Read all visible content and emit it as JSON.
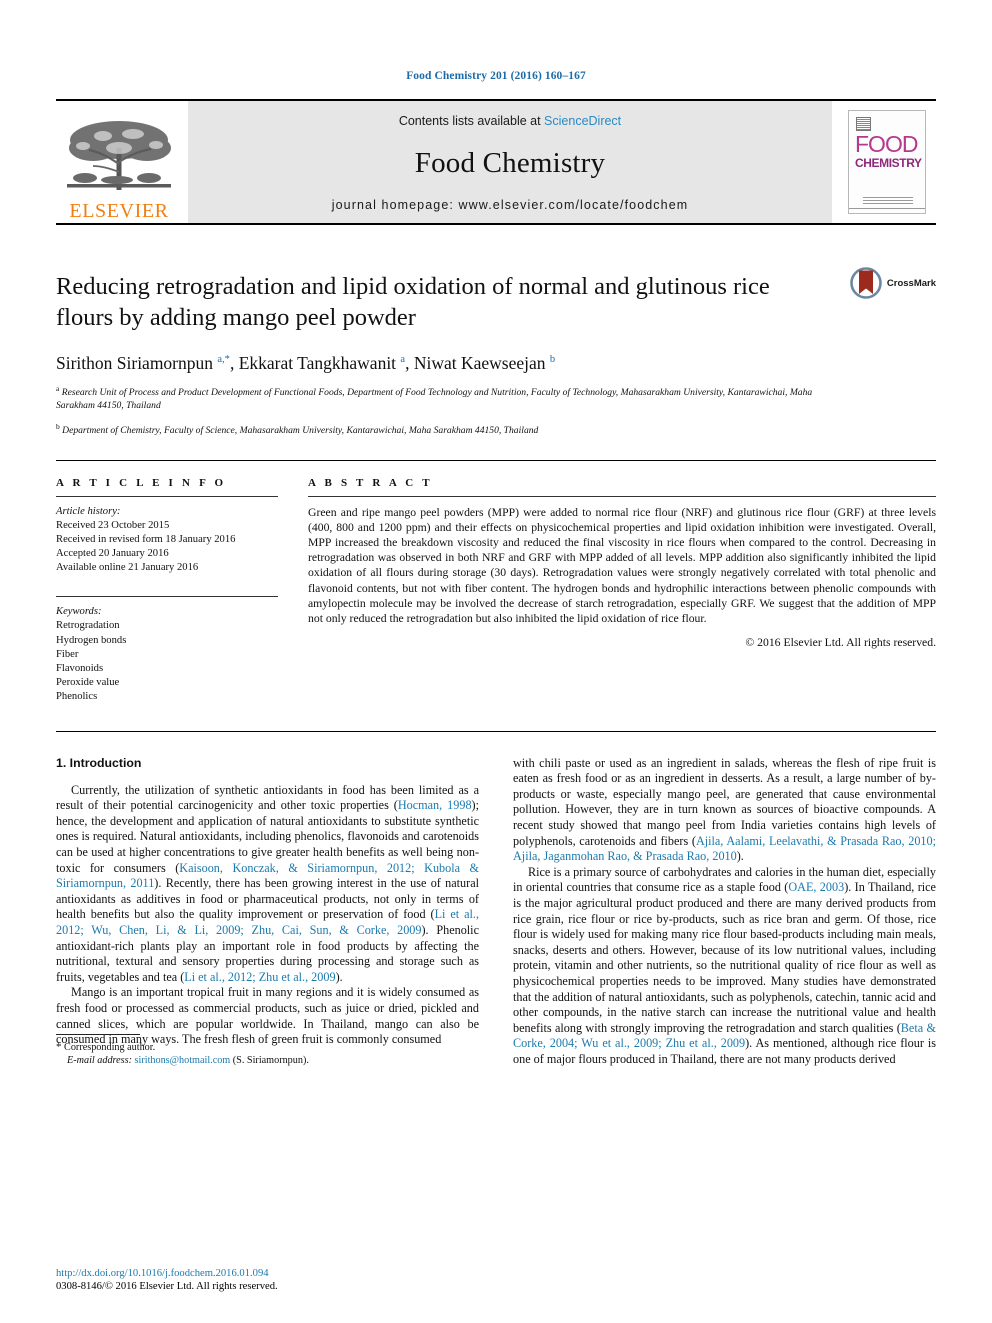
{
  "running_head": "Food Chemistry 201 (2016) 160–167",
  "masthead": {
    "publisher": "ELSEVIER",
    "contents_prefix": "Contents lists available at ",
    "contents_link": "ScienceDirect",
    "journal_title": "Food Chemistry",
    "homepage": "journal homepage: www.elsevier.com/locate/foodchem",
    "cover": {
      "line1": "FOOD",
      "line2": "CHEMISTRY"
    },
    "accent_link_color": "#2a8bc4",
    "elsevier_orange": "#f07f13",
    "cover_magenta": "#b5388f"
  },
  "article": {
    "title": "Reducing retrogradation and lipid oxidation of normal and glutinous rice flours by adding mango peel powder",
    "crossmark_label": "CrossMark",
    "authors_html": "Sirithon Siriamornpun <sup>a,*</sup>, Ekkarat Tangkhawanit <sup>a</sup>, Niwat Kaewseejan <sup>b</sup>",
    "affiliation_a": "Research Unit of Process and Product Development of Functional Foods, Department of Food Technology and Nutrition, Faculty of Technology, Mahasarakham University, Kantarawichai, Maha Sarakham 44150, Thailand",
    "affiliation_b": "Department of Chemistry, Faculty of Science, Mahasarakham University, Kantarawichai, Maha Sarakham 44150, Thailand"
  },
  "article_info": {
    "heading": "A R T I C L E  I N F O",
    "history_label": "Article history:",
    "history": [
      "Received 23 October 2015",
      "Received in revised form 18 January 2016",
      "Accepted 20 January 2016",
      "Available online 21 January 2016"
    ],
    "keywords_label": "Keywords:",
    "keywords": [
      "Retrogradation",
      "Hydrogen bonds",
      "Fiber",
      "Flavonoids",
      "Peroxide value",
      "Phenolics"
    ]
  },
  "abstract": {
    "heading": "A B S T R A C T",
    "text": "Green and ripe mango peel powders (MPP) were added to normal rice flour (NRF) and glutinous rice flour (GRF) at three levels (400, 800 and 1200 ppm) and their effects on physicochemical properties and lipid oxidation inhibition were investigated. Overall, MPP increased the breakdown viscosity and reduced the final viscosity in rice flours when compared to the control. Decreasing in retrogradation was observed in both NRF and GRF with MPP added of all levels. MPP addition also significantly inhibited the lipid oxidation of all flours during storage (30 days). Retrogradation values were strongly negatively correlated with total phenolic and flavonoid contents, but not with fiber content. The hydrogen bonds and hydrophilic interactions between phenolic compounds with amylopectin molecule may be involved the decrease of starch retrogradation, especially GRF. We suggest that the addition of MPP not only reduced the retrogradation but also inhibited the lipid oxidation of rice flour.",
    "copyright": "© 2016 Elsevier Ltd. All rights reserved."
  },
  "introduction": {
    "section_number_title": "1. Introduction",
    "left_paragraphs_html": [
      "Currently, the utilization of synthetic antioxidants in food has been limited as a result of their potential carcinogenicity and other toxic properties (<span class=\"ref\">Hocman, 1998</span>); hence, the development and application of natural antioxidants to substitute synthetic ones is required. Natural antioxidants, including phenolics, flavonoids and carotenoids can be used at higher concentrations to give greater health benefits as well being non-toxic for consumers (<span class=\"ref\">Kaisoon, Konczak, &amp; Siriamornpun, 2012; Kubola &amp; Siriamornpun, 2011</span>). Recently, there has been growing interest in the use of natural antioxidants as additives in food or pharmaceutical products, not only in terms of health benefits but also the quality improvement or preservation of food (<span class=\"ref\">Li et al., 2012; Wu, Chen, Li, &amp; Li, 2009; Zhu, Cai, Sun, &amp; Corke, 2009</span>). Phenolic antioxidant-rich plants play an important role in food products by affecting the nutritional, textural and sensory properties during processing and storage such as fruits, vegetables and tea (<span class=\"ref\">Li et al., 2012; Zhu et al., 2009</span>).",
      "Mango is an important tropical fruit in many regions and it is widely consumed as fresh food or processed as commercial products, such as juice or dried, pickled and canned slices, which are popular worldwide. In Thailand, mango can also be consumed in many ways. The fresh flesh of green fruit is commonly consumed"
    ],
    "right_paragraphs_html": [
      "with chili paste or used as an ingredient in salads, whereas the flesh of ripe fruit is eaten as fresh food or as an ingredient in desserts. As a result, a large number of by-products or waste, especially mango peel, are generated that cause environmental pollution. However, they are in turn known as sources of bioactive compounds. A recent study showed that mango peel from India varieties contains high levels of polyphenols, carotenoids and fibers (<span class=\"ref\">Ajila, Aalami, Leelavathi, &amp; Prasada Rao, 2010; Ajila, Jaganmohan Rao, &amp; Prasada Rao, 2010</span>).",
      "Rice is a primary source of carbohydrates and calories in the human diet, especially in oriental countries that consume rice as a staple food (<span class=\"ref\">OAE, 2003</span>). In Thailand, rice is the major agricultural product produced and there are many derived products from rice grain, rice flour or rice by-products, such as rice bran and germ. Of those, rice flour is widely used for making many rice flour based-products including main meals, snacks, deserts and others. However, because of its low nutritional values, including protein, vitamin and other nutrients, so the nutritional quality of rice flour as well as physicochemical properties needs to be improved. Many studies have demonstrated that the addition of natural antioxidants, such as polyphenols, catechin, tannic acid and other compounds, in the native starch can increase the nutritional value and health benefits along with strongly improving the retrogradation and starch qualities (<span class=\"ref\">Beta &amp; Corke, 2004; Wu et al., 2009; Zhu et al., 2009</span>). As mentioned, although rice flour is one of major flours produced in Thailand, there are not many products derived"
    ]
  },
  "footnote": {
    "corresponding": "Corresponding author.",
    "email_label": "E-mail address:",
    "email": "sirithons@hotmail.com",
    "email_owner": "(S. Siriamornpun)."
  },
  "page_footer": {
    "doi": "http://dx.doi.org/10.1016/j.foodchem.2016.01.094",
    "issn_line": "0308-8146/© 2016 Elsevier Ltd. All rights reserved."
  }
}
